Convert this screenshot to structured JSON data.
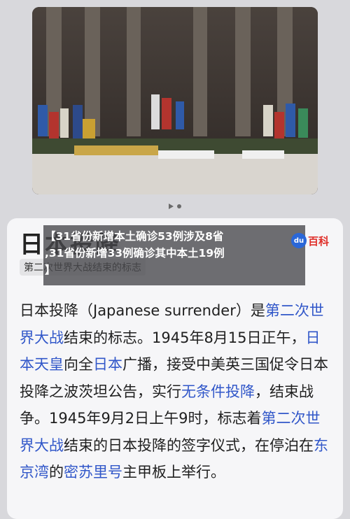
{
  "pager": {
    "play_icon": "play-icon",
    "active_dot": "dot-indicator"
  },
  "article": {
    "headline": "日本投降",
    "subtitle": "第二次世界大战结束的标志"
  },
  "overlay": {
    "title_line1": "【31省份新增本土确诊53例涉及8省",
    "title_line2": ",31省份新增33例确诊其中本土19例",
    "title_line3": "】"
  },
  "logo": {
    "mark": "du",
    "text": "百科",
    "colors": {
      "mark": "#2a67d8",
      "text": "#e0312b"
    }
  },
  "body": {
    "s1": "日本投降（Japanese surrender）是",
    "l1": "第二次世界大战",
    "s2": "结束的标志。1945年8月15日正午，",
    "l2": "日本天皇",
    "s3": "向全",
    "l3": "日本",
    "s4": "广播，接受中美英三国促令日本投降之波茨坦公告，实行",
    "l4": "无条件投降",
    "s5": "，结束战争。1945年9月2日上午9时，标志着",
    "l5": "第二次世界大战",
    "s6": "结束的日本投降的签字仪式，在停泊在",
    "l6": "东京湾",
    "s7": "的",
    "l7": "密苏里号",
    "s8": "主甲板上举行。",
    "link_color": "#3157c9"
  }
}
